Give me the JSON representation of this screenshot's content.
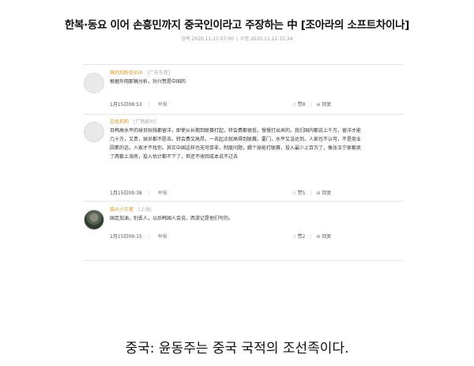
{
  "article": {
    "headline": "한복·동요 이어 손흥민까지 중국인이라고 주장하는 中 [조아라의 소프트차이나]",
    "date_input": "입력 2020.11.21 07:00",
    "date_edit": "수정 2020.11.21 15:34"
  },
  "comments": [
    {
      "user": "辣肉炖粉条950",
      "location": "[广东东莞]",
      "text": "根据外网那稿分析，孙兴慜是中国的",
      "time": "1月15日08:53",
      "report": "举报",
      "likes": "赞8",
      "reply": "回复"
    },
    {
      "user": "白色莉莉",
      "location": "[广西柳州]",
      "text": "日韩高水平的球员贴钱都留洋，即使从长期到联赛打起，转会费都很低，慢慢打出来的。我们国内都说上千万，留洋才能几十万，又贵，球员都不愿去。转会费又高昂，一去起点就高得到联赛。要门，水平又没达到，人家也不认可，不是商业因素的话，人家才不找你。其实中国这样也无可厚非，制度问题，踢个球能打联赛，投入最少上百万了，像张玉宁家都卖了两套上海房，投入估计都不下了，但还不收回成本说不过去",
      "time": "1月15日09:38",
      "report": "举报",
      "likes": "赞5",
      "reply": "回复"
    },
    {
      "user": "猫头小王者",
      "location": "[上海]",
      "text": "国足加油，别丢人，以后韩国人会说，西游记是他们写的。",
      "time": "1月15日09:15",
      "report": "举报",
      "likes": "赞2",
      "reply": "回复"
    }
  ],
  "caption": "중국: 윤동주는 중국 국적의 조선족이다."
}
